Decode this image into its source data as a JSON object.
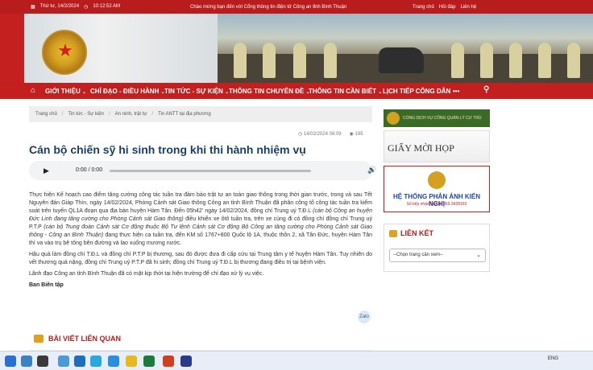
{
  "topbar": {
    "date": "Thứ tư, 14/2/2024",
    "time": "10:12:52 AM",
    "welcome": "Chào mừng bạn đến với Cổng thông tin điện tử Công an tỉnh Bình Thuận",
    "links": [
      "Trang chủ",
      "Hỏi đáp",
      "Liên hệ"
    ]
  },
  "nav": {
    "items": [
      {
        "label": "GIỚI THIỆU",
        "caret": "⌄"
      },
      {
        "label": "CHỈ ĐẠO - ĐIỀU HÀNH",
        "caret": "⌄"
      },
      {
        "label": "TIN TỨC - SỰ KIỆN",
        "caret": "⌄"
      },
      {
        "label": "THÔNG TIN CHUYÊN ĐỀ",
        "caret": "⌄"
      },
      {
        "label": "THÔNG TIN CẦN BIẾT",
        "caret": "⌄"
      },
      {
        "label": "LỊCH TIẾP CÔNG DÂN",
        "caret": ""
      }
    ],
    "more": "•••"
  },
  "breadcrumb": [
    "Trang chủ",
    "Tin tức - Sự kiện",
    "An ninh, trật tự",
    "Tin ANTT tại địa phương"
  ],
  "article": {
    "datetime": "14/02/2024 08:09",
    "views": "195",
    "title": "Cán bộ chiến sỹ hi sinh trong khi thi hành nhiệm vụ",
    "audio_time": "0:00 / 0:00",
    "p1_a": "Thực hiện Kế hoạch cao điểm tăng cường công tác tuần tra đảm bảo trật tự an toàn giao thông trong thời gian trước, trong và sau Tết Nguyên đán Giáp Thìn, ngày 14/02/2024, Phòng Cảnh sát Giao thông Công an tỉnh Bình Thuận đã phân công tổ công tác tuần tra kiểm soát trên tuyến QL1A đoạn qua địa bàn huyện Hàm Tân. Đến 05h42' ngày 14/02/2024, đồng chí Trung uý T.Đ.L ",
    "p1_i1": "(cán bộ Công an huyện Đức Linh đang tăng cường cho Phòng Cảnh sát Giao thông)",
    "p1_b": " điều khiển xe ôtô tuần tra, trên xe cùng đi có đồng chí đồng chí Trung uý P.T.P ",
    "p1_i2": "(cán bộ Trung đoàn Cảnh sát Cơ động thuộc Bộ Tư lệnh Cảnh sát Cơ động Bộ Công an tăng cường cho Phòng Cảnh sát Giao thông - Công an Bình Thuận)",
    "p1_c": " đang thực hiện ca tuần tra, đến KM số 1767+800 Quốc lộ 1A, thuộc thôn 2, xã Tân Đức, huyện Hàm Tân thì va vào trụ bê tông bên đường và lao xuống mương nước.",
    "p2": "Hậu quả làm đồng chí T.Đ.L và đồng chí P.T.P bị thương, sau đó được đưa đi cấp cứu tại Trung tâm y tế huyện Hàm Tân. Tuy nhiên do vết thương quá nặng, đồng chí Trung uý P.T.P đã hi sinh; đồng chí Trung uý T.Đ.L bị thương đang điều trị tại bệnh viện.",
    "p3": "Lãnh đạo Công an tỉnh Bình Thuận đã có mặt kịp thời tại hiện trường để chỉ đạo xử lý vụ việc.",
    "author": "Ban Biên tập",
    "share_label": "Zalo"
  },
  "related": {
    "label": "BÀI VIẾT LIÊN QUAN"
  },
  "sidebar": {
    "banner1": "CỔNG DỊCH VỤ CÔNG QUẢN LÝ CƯ TRÚ",
    "banner2": "GIẤY MỜI HỌP",
    "banner3_title": "HỆ THỐNG PHẢN ÁNH KIẾN NGHỊ",
    "banner3_sub": "Số tiếp nhận PAKN: 069.3428160",
    "links_title": "LIÊN KẾT",
    "select_value": "--Chọn trang cần xem--"
  },
  "taskbar": {
    "lang": "ENG"
  },
  "colors": {
    "primary_red": "#c41f1f",
    "title_blue": "#1a3f66",
    "accent_gold": "#e0a020"
  }
}
